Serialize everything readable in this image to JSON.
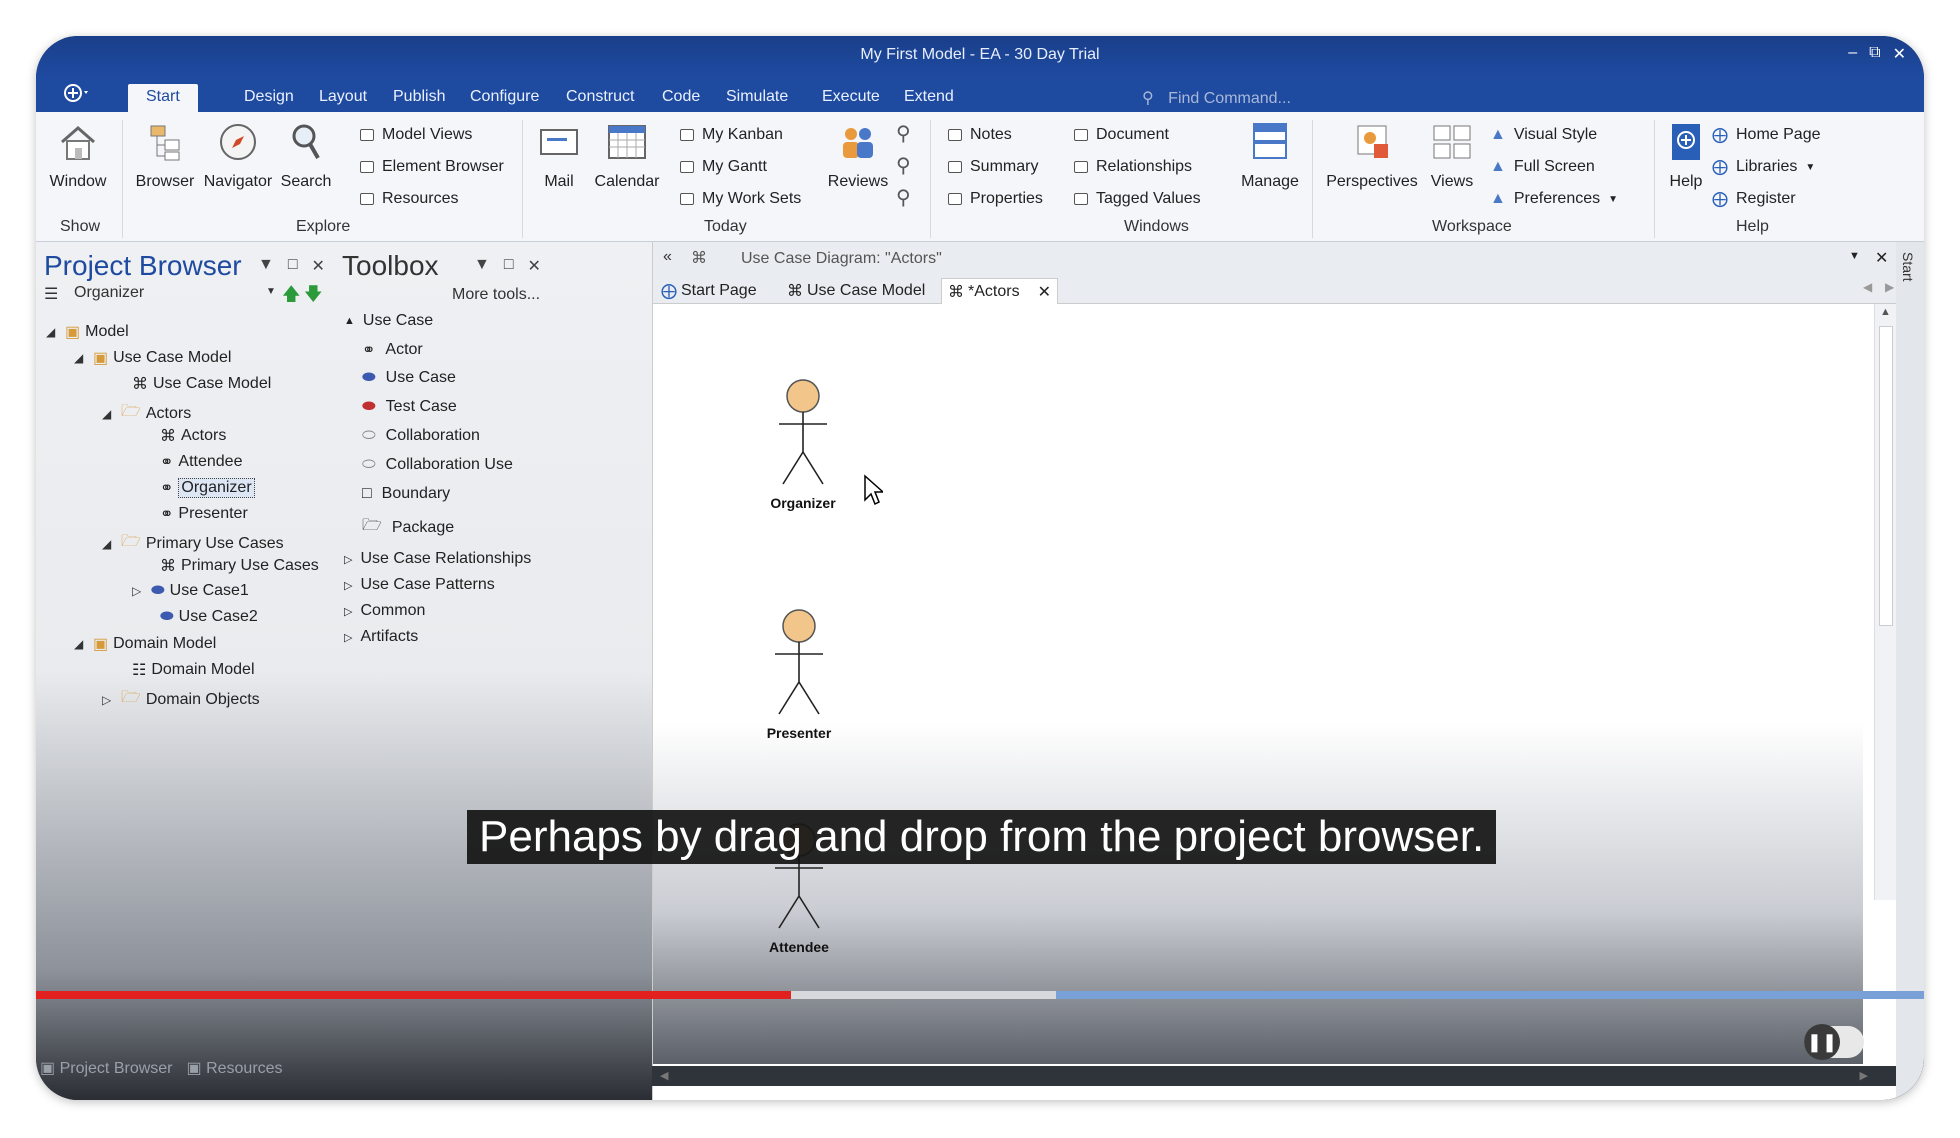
{
  "window": {
    "title": "My First Model - EA - 30 Day Trial",
    "controls": [
      "–",
      "⧉",
      "✕"
    ]
  },
  "ribbon_tabs": [
    "Start",
    "Design",
    "Layout",
    "Publish",
    "Configure",
    "Construct",
    "Code",
    "Simulate",
    "Execute",
    "Extend"
  ],
  "find_command": "Find Command...",
  "ribbon": {
    "show": {
      "label": "Show",
      "window": "Window"
    },
    "explore": {
      "label": "Explore",
      "browser": "Browser",
      "navigator": "Navigator",
      "search": "Search",
      "model_views": "Model Views",
      "element_browser": "Element Browser",
      "resources": "Resources"
    },
    "today": {
      "label": "Today",
      "mail": "Mail",
      "calendar": "Calendar",
      "my_kanban": "My Kanban",
      "my_gantt": "My Gantt",
      "my_work_sets": "My Work Sets",
      "reviews": "Reviews"
    },
    "windows": {
      "label": "Windows",
      "notes": "Notes",
      "summary": "Summary",
      "properties": "Properties",
      "document": "Document",
      "relationships": "Relationships",
      "tagged_values": "Tagged Values",
      "manage": "Manage"
    },
    "workspace": {
      "label": "Workspace",
      "perspectives": "Perspectives",
      "views": "Views",
      "visual_style": "Visual Style",
      "full_screen": "Full Screen",
      "preferences": "Preferences"
    },
    "help": {
      "label": "Help",
      "help": "Help",
      "home_page": "Home Page",
      "libraries": "Libraries",
      "register": "Register"
    }
  },
  "project_browser": {
    "title": "Project Browser",
    "selector": "Organizer",
    "tree": {
      "model": "Model",
      "use_case_model_pkg": "Use Case Model",
      "use_case_model_diag": "Use Case Model",
      "actors_pkg": "Actors",
      "actors_diag": "Actors",
      "attendee": "Attendee",
      "organizer": "Organizer",
      "presenter": "Presenter",
      "primary_pkg": "Primary Use Cases",
      "primary_diag": "Primary Use Cases",
      "use_case1": "Use Case1",
      "use_case2": "Use Case2",
      "domain_pkg": "Domain Model",
      "domain_diag": "Domain Model",
      "domain_objects": "Domain Objects"
    }
  },
  "toolbox": {
    "title": "Toolbox",
    "more_tools": "More tools...",
    "use_case_group": "Use Case",
    "items": [
      "Actor",
      "Use Case",
      "Test Case",
      "Collaboration",
      "Collaboration Use",
      "Boundary",
      "Package"
    ],
    "groups": [
      "Use Case Relationships",
      "Use Case Patterns",
      "Common",
      "Artifacts"
    ]
  },
  "diagram": {
    "header": "Use Case Diagram: \"Actors\"",
    "tabs": [
      "Start Page",
      "Use Case Model",
      "*Actors"
    ],
    "actors": [
      "Organizer",
      "Presenter",
      "Attendee"
    ]
  },
  "right_strip": "Start",
  "bottom_tabs": [
    "Project Browser",
    "Resources"
  ],
  "caption": "Perhaps by drag and drop from the project browser.",
  "video": {
    "progress_percent": 40,
    "buffered_percent": 54
  },
  "colors": {
    "accent": "#1e4aa0",
    "progress": "#e22020"
  }
}
